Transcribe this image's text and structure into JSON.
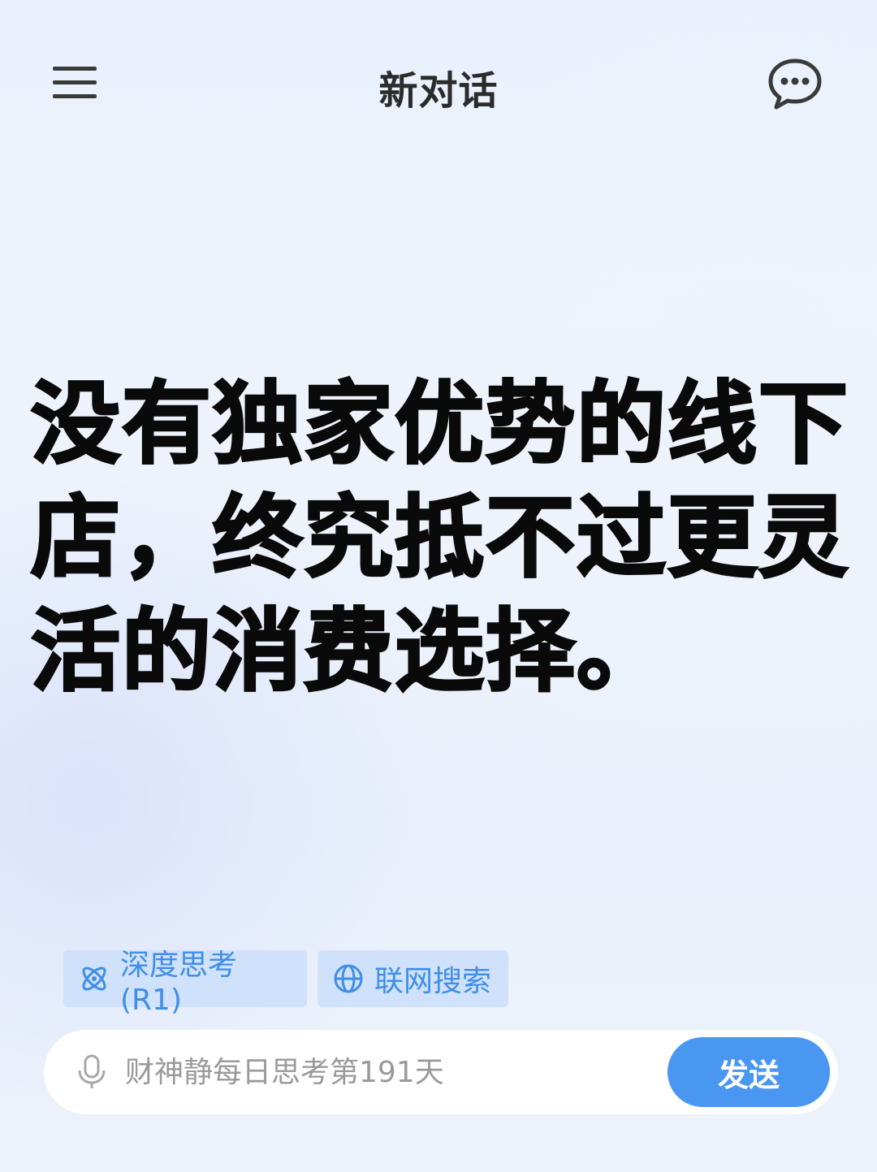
{
  "header": {
    "title": "新对话"
  },
  "headline": {
    "text": "没有独家优势的线下店，终究抵不过更灵活的消费选择。"
  },
  "chips": {
    "deep_think": "深度思考(R1)",
    "web_search": "联网搜索"
  },
  "input": {
    "placeholder": "财神静每日思考第191天",
    "value": ""
  },
  "send_button": {
    "label": "发送"
  },
  "colors": {
    "accent": "#4a97f1",
    "chip_bg": "#cfe1fb",
    "chip_text": "#3f8ee8",
    "headline": "#0a0a0a"
  },
  "icons": {
    "menu": "menu-icon",
    "chat": "chat-bubble-icon",
    "deep_think": "atom-icon",
    "web_search": "globe-icon",
    "mic": "microphone-icon"
  }
}
